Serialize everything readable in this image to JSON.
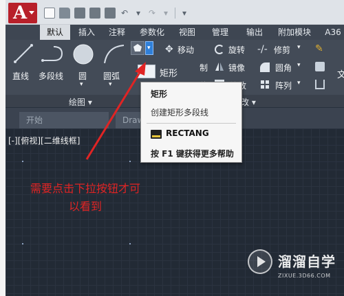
{
  "app": {
    "logo_letter": "A"
  },
  "ribbon_tabs": [
    {
      "label": "默认",
      "active": true
    },
    {
      "label": "插入"
    },
    {
      "label": "注释"
    },
    {
      "label": "参数化"
    },
    {
      "label": "视图"
    },
    {
      "label": "管理"
    },
    {
      "label": "输出"
    },
    {
      "label": "附加模块"
    },
    {
      "label": "A36"
    }
  ],
  "draw_panel": {
    "line": "直线",
    "polyline": "多段线",
    "circle": "圆",
    "arc": "圆弧",
    "rectangle": "矩形",
    "panel_label": "绘图 ▾"
  },
  "modify_panel": {
    "move": "移动",
    "rotate": "旋转",
    "trim": "修剪",
    "mirror": "镜像",
    "fillet": "圆角",
    "scale": "缩放",
    "array": "阵列",
    "copy_partial": "制",
    "stretch_partial": "伸",
    "panel_label": "修改 ▾"
  },
  "text_tool_partial": "文",
  "doc_tabs": {
    "start": "开始",
    "drawing": "Draw"
  },
  "viewport_label": "[-][俯视][二维线框]",
  "tooltip": {
    "title": "矩形",
    "description": "创建矩形多段线",
    "command": "RECTANG",
    "help": "按 F1 键获得更多帮助"
  },
  "annotation": "需要点击下拉按钮才可以看到",
  "watermark": {
    "name": "溜溜自学",
    "url": "ZIXUE.3D66.COM"
  },
  "colors": {
    "accent_red": "#e02424",
    "app_button": "#b8202a",
    "ribbon_bg": "#434b57",
    "canvas_bg": "#222a35"
  }
}
